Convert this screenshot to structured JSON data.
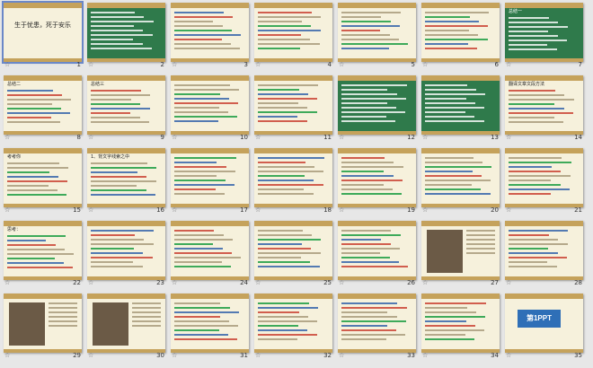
{
  "slides": [
    {
      "n": "1",
      "title": "生于忧患，死于安乐",
      "type": "title"
    },
    {
      "n": "2",
      "type": "text"
    },
    {
      "n": "3",
      "type": "text"
    },
    {
      "n": "4",
      "type": "text"
    },
    {
      "n": "5",
      "type": "text"
    },
    {
      "n": "6",
      "type": "text"
    },
    {
      "n": "7",
      "title": "总结一",
      "type": "text"
    },
    {
      "n": "8",
      "title": "总结二",
      "type": "text"
    },
    {
      "n": "9",
      "title": "总结三",
      "type": "text"
    },
    {
      "n": "10",
      "type": "text"
    },
    {
      "n": "11",
      "type": "text"
    },
    {
      "n": "12",
      "type": "text"
    },
    {
      "n": "13",
      "type": "text"
    },
    {
      "n": "14",
      "title": "翻译文章文段方法",
      "type": "text"
    },
    {
      "n": "15",
      "title": "考考你",
      "type": "text"
    },
    {
      "n": "16",
      "title": "1、背文字线索之中",
      "type": "text"
    },
    {
      "n": "17",
      "type": "text"
    },
    {
      "n": "18",
      "type": "text"
    },
    {
      "n": "19",
      "type": "text"
    },
    {
      "n": "20",
      "type": "text"
    },
    {
      "n": "21",
      "type": "text"
    },
    {
      "n": "22",
      "title": "思考：",
      "type": "text"
    },
    {
      "n": "23",
      "type": "diagram"
    },
    {
      "n": "24",
      "type": "text"
    },
    {
      "n": "25",
      "type": "text"
    },
    {
      "n": "26",
      "type": "text"
    },
    {
      "n": "27",
      "type": "image"
    },
    {
      "n": "28",
      "type": "text"
    },
    {
      "n": "29",
      "type": "image"
    },
    {
      "n": "30",
      "type": "image"
    },
    {
      "n": "31",
      "type": "text"
    },
    {
      "n": "32",
      "type": "text"
    },
    {
      "n": "33",
      "type": "text"
    },
    {
      "n": "34",
      "type": "text"
    },
    {
      "n": "35",
      "type": "ppt"
    }
  ],
  "ppt_label": "第1PPT"
}
